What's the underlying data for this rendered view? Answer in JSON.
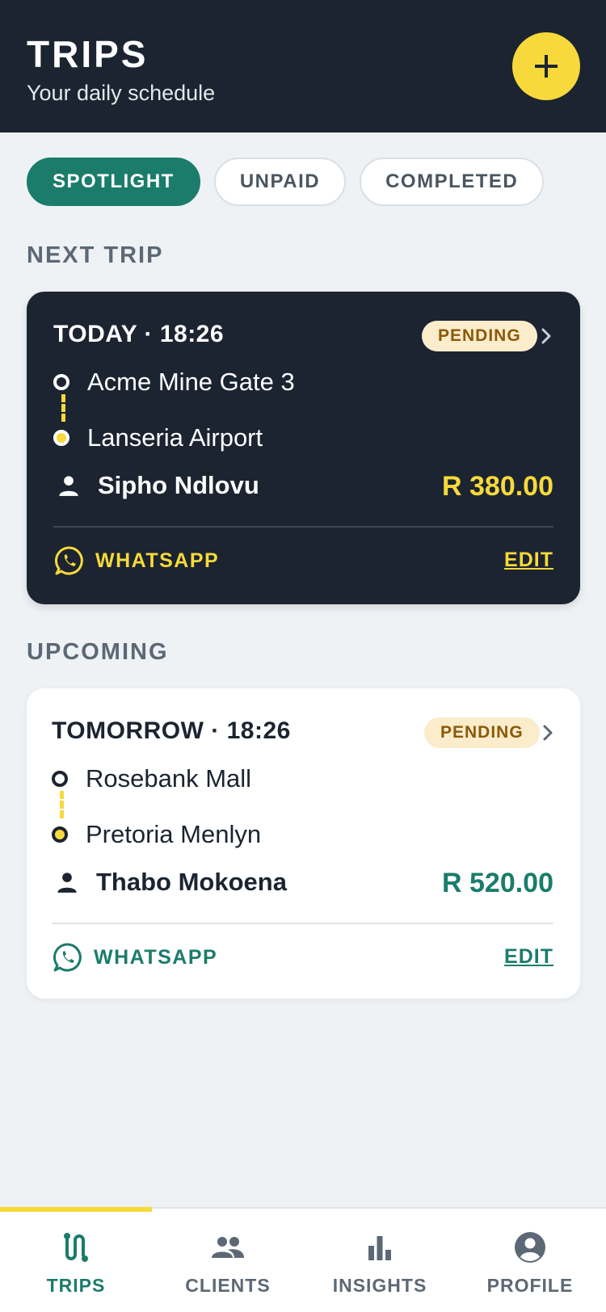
{
  "header": {
    "title": "TRIPS",
    "subtitle": "Your daily schedule",
    "add_icon": "plus-icon"
  },
  "tabs": [
    {
      "label": "SPOTLIGHT",
      "active": true
    },
    {
      "label": "UNPAID",
      "active": false
    },
    {
      "label": "COMPLETED",
      "active": false
    }
  ],
  "sections": {
    "next": "NEXT TRIP",
    "upcoming": "UPCOMING"
  },
  "trips": [
    {
      "when": "TODAY · 18:26",
      "status": "PENDING",
      "pickup": "Acme Mine Gate 3",
      "dropoff": "Lanseria Airport",
      "client": "Sipho Ndlovu",
      "price": "R 380.00",
      "whatsapp_label": "WHATSAPP",
      "edit_label": "EDIT"
    },
    {
      "when": "TOMORROW · 18:26",
      "status": "PENDING",
      "pickup": "Rosebank Mall",
      "dropoff": "Pretoria Menlyn",
      "client": "Thabo Mokoena",
      "price": "R 520.00",
      "whatsapp_label": "WHATSAPP",
      "edit_label": "EDIT"
    }
  ],
  "nav": [
    {
      "label": "TRIPS",
      "icon": "route-icon",
      "active": true
    },
    {
      "label": "CLIENTS",
      "icon": "people-icon",
      "active": false
    },
    {
      "label": "INSIGHTS",
      "icon": "bar-chart-icon",
      "active": false
    },
    {
      "label": "PROFILE",
      "icon": "account-circle-icon",
      "active": false
    }
  ],
  "colors": {
    "accent": "#f7d93b",
    "primary": "#1b7c6b",
    "dark": "#1b2430",
    "background": "#eef2f5"
  }
}
